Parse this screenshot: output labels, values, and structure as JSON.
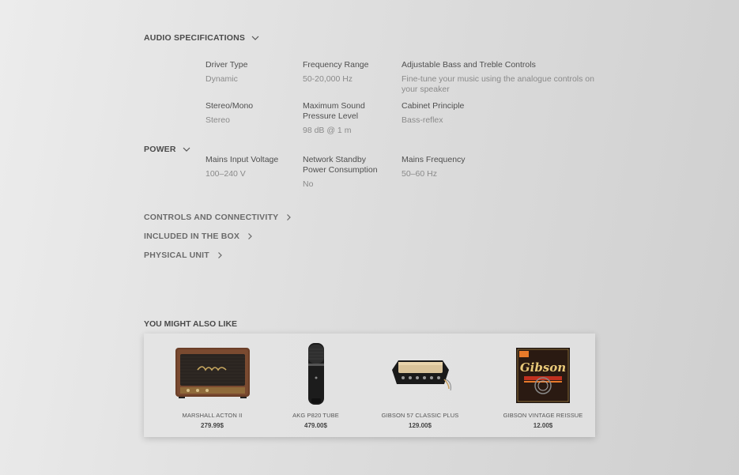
{
  "sections": {
    "audio": {
      "title": "AUDIO SPECIFICATIONS"
    },
    "power": {
      "title": "POWER"
    },
    "controls": {
      "title": "CONTROLS AND CONNECTIVITY"
    },
    "box": {
      "title": "INCLUDED IN THE BOX"
    },
    "physical": {
      "title": "PHYSICAL UNIT"
    }
  },
  "audio_specs": [
    {
      "name": "Driver Type",
      "value": "Dynamic"
    },
    {
      "name": "Frequency Range",
      "value": "50-20,000 Hz"
    },
    {
      "name": "Adjustable Bass and Treble Controls",
      "value": "Fine-tune your music using the analogue controls on your speaker"
    },
    {
      "name": "Stereo/Mono",
      "value": "Stereo"
    },
    {
      "name": "Maximum Sound Pressure Level",
      "value": "98 dB @ 1 m"
    },
    {
      "name": "Cabinet Principle",
      "value": "Bass-reflex"
    }
  ],
  "power_specs": [
    {
      "name": "Mains Input Voltage",
      "value": "100–240 V"
    },
    {
      "name": "Network Standby Power Consumption",
      "value": "No"
    },
    {
      "name": "Mains Frequency",
      "value": "50–60 Hz"
    }
  ],
  "recommend": {
    "title": "YOU MIGHT ALSO LIKE",
    "products": [
      {
        "name": "MARSHALL ACTON II",
        "price": "279.99$",
        "icon": "speaker"
      },
      {
        "name": "AKG P820 TUBE",
        "price": "479.00$",
        "icon": "microphone"
      },
      {
        "name": "GIBSON 57 CLASSIC PLUS",
        "price": "129.00$",
        "icon": "pickup"
      },
      {
        "name": "GIBSON VINTAGE REISSUE",
        "price": "12.00$",
        "icon": "guitar-strings"
      }
    ],
    "string_pack_brand": "Gibson"
  },
  "colors": {
    "text": "#555555",
    "muted": "#8a8a8a",
    "accent_orange": "#e87a2a"
  }
}
